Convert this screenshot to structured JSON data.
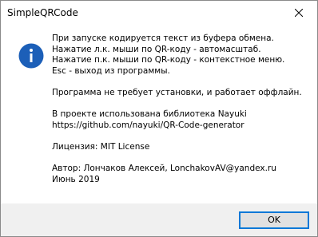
{
  "window": {
    "title": "SimpleQRCode"
  },
  "icons": {
    "info": "information-icon",
    "close": "close-icon"
  },
  "colors": {
    "info_icon": "#1c5fb8",
    "button_border": "#0078d7",
    "footer_bg": "#f0f0f0"
  },
  "message": {
    "lines": [
      "При запуске кодируется текст из буфера обмена.",
      "Нажатие л.к. мыши по QR-коду - автомасштаб.",
      "Нажатие п.к. мыши по QR-коду - контекстное меню.",
      "Esc - выход из программы.",
      "",
      "Программа не требует установки, и работает оффлайн.",
      "",
      "В проекте использована библиотека Nayuki",
      "https://github.com/nayuki/QR-Code-generator",
      "",
      "Лицензия: MIT License",
      "",
      "Автор: Лончаков Алексей, LonchakovAV@yandex.ru",
      "Июнь 2019"
    ]
  },
  "buttons": {
    "ok_label": "OK"
  }
}
